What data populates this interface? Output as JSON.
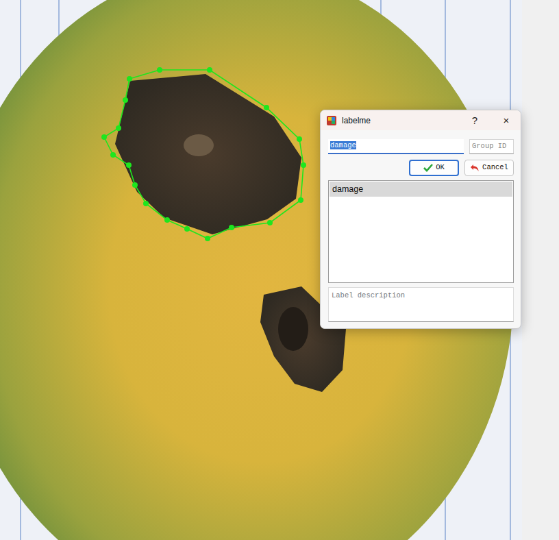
{
  "window": {
    "title": "labelme",
    "help": "?",
    "close": "×"
  },
  "label_field": {
    "value": "damage",
    "selected": true
  },
  "group_id": {
    "placeholder": "Group ID"
  },
  "buttons": [
    {
      "label": "OK",
      "kind": "ok"
    },
    {
      "label": "Cancel",
      "kind": "cancel"
    }
  ],
  "labels": [
    {
      "text": "damage",
      "selected": true
    }
  ],
  "description": {
    "placeholder": "Label description"
  }
}
